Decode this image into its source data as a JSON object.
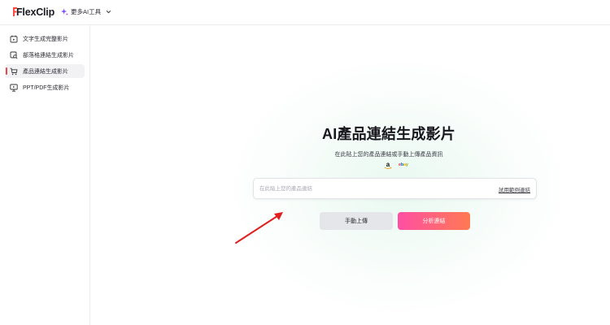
{
  "header": {
    "logo_text": "FlexClip",
    "ai_tools_label": "更多AI工具",
    "icons": {
      "ai_tools": "sparkle-icon",
      "dropdown": "chevron-down-icon"
    }
  },
  "sidebar": {
    "items": [
      {
        "label": "文字生成完整影片",
        "icon": "calendar-video-icon",
        "active": false
      },
      {
        "label": "部落格連結生成影片",
        "icon": "link-search-icon",
        "active": false
      },
      {
        "label": "產品連結生成影片",
        "icon": "cart-icon",
        "active": true
      },
      {
        "label": "PPT/PDF生成影片",
        "icon": "presentation-icon",
        "active": false
      }
    ],
    "active_indicator_color": "#e6484f"
  },
  "main": {
    "title": "AI產品連結生成影片",
    "subtitle": "在此貼上您的產品連結或手動上傳產品資訊",
    "brands": [
      {
        "name": "amazon",
        "icon": "amazon-icon"
      },
      {
        "name": "ebay",
        "icon": "ebay-icon",
        "letters": [
          "e",
          "b",
          "a",
          "y"
        ]
      }
    ],
    "url_input": {
      "placeholder": "在此貼上您的產品連結",
      "value": ""
    },
    "try_link": "試用範例連結",
    "buttons": {
      "upload": "手動上傳",
      "analyze": "分析連結"
    },
    "annotation": {
      "icon": "red-arrow-annotation",
      "color": "#e02020"
    }
  },
  "colors": {
    "accent_gradient_start": "#ff4fa3",
    "accent_gradient_end": "#ff7a52",
    "secondary_button": "#e4e6ea"
  }
}
